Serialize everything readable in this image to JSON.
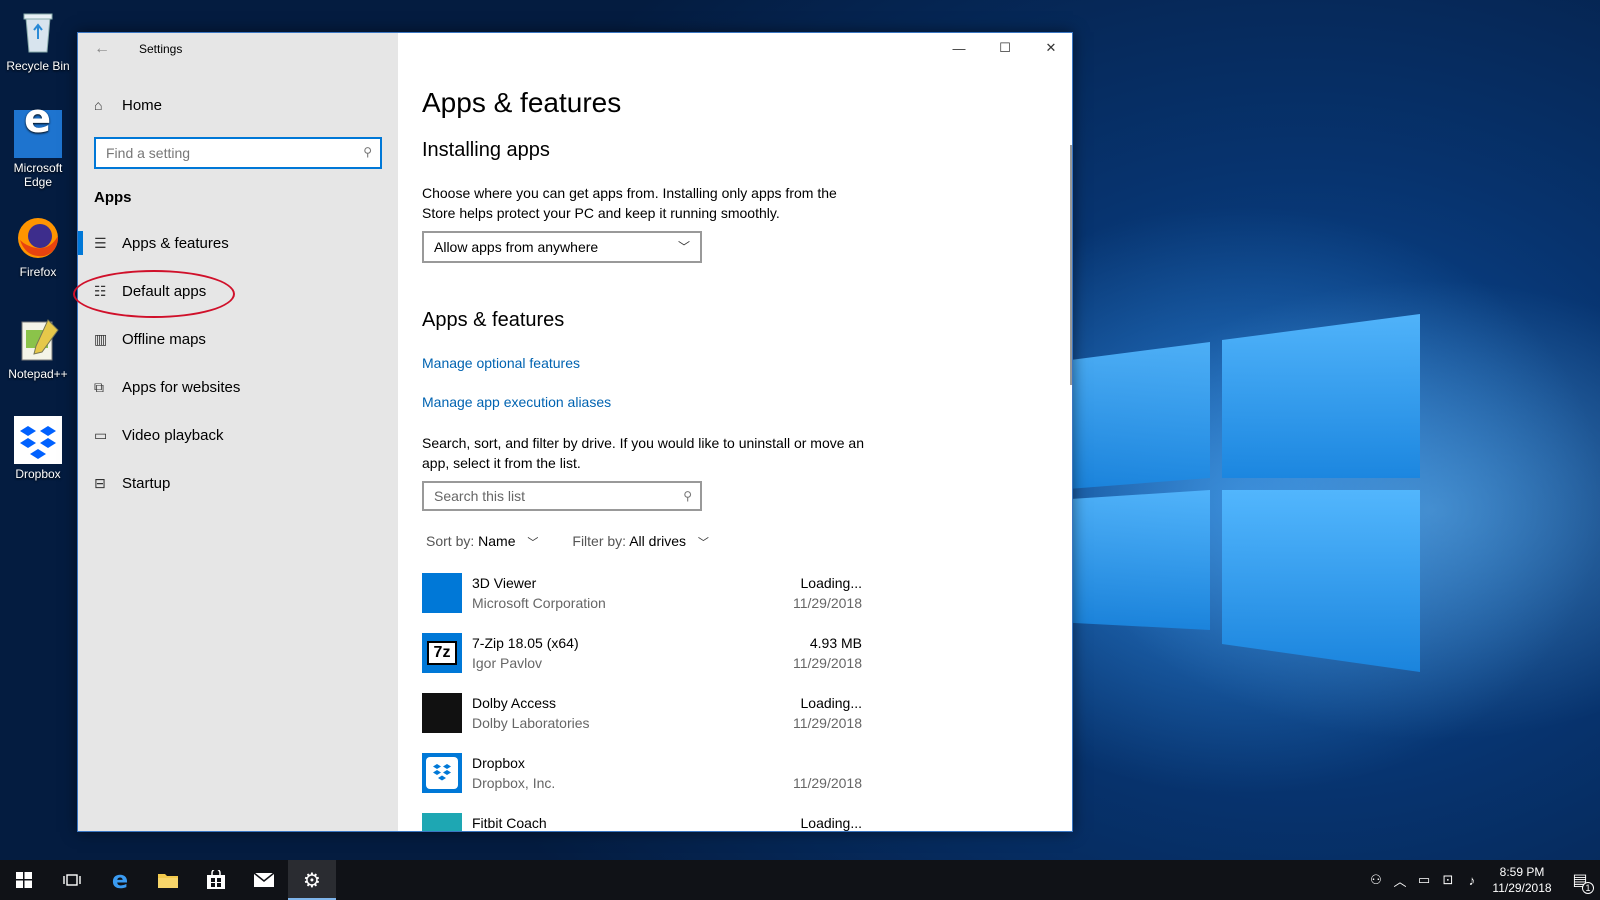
{
  "desktop": {
    "icons": [
      {
        "label_line1": "Recycle Bin",
        "label_line2": "",
        "icon": "recycle-bin-icon"
      },
      {
        "label_line1": "Microsoft",
        "label_line2": "Edge",
        "icon": "edge-icon"
      },
      {
        "label_line1": "Firefox",
        "label_line2": "",
        "icon": "firefox-icon"
      },
      {
        "label_line1": "Notepad++",
        "label_line2": "",
        "icon": "notepadpp-icon"
      },
      {
        "label_line1": "Dropbox",
        "label_line2": "",
        "icon": "dropbox-icon"
      }
    ]
  },
  "window": {
    "title": "Settings",
    "controls": {
      "minimize": "—",
      "maximize": "☐",
      "close": "✕"
    }
  },
  "sidebar": {
    "home_label": "Home",
    "search_placeholder": "Find a setting",
    "section_label": "Apps",
    "items": [
      {
        "label": "Apps & features",
        "icon": "list-icon",
        "active": true
      },
      {
        "label": "Default apps",
        "icon": "default-apps-icon",
        "active": false,
        "highlighted": true
      },
      {
        "label": "Offline maps",
        "icon": "map-icon",
        "active": false
      },
      {
        "label": "Apps for websites",
        "icon": "websites-icon",
        "active": false
      },
      {
        "label": "Video playback",
        "icon": "video-icon",
        "active": false
      },
      {
        "label": "Startup",
        "icon": "startup-icon",
        "active": false
      }
    ]
  },
  "main": {
    "page_title": "Apps & features",
    "installing": {
      "heading": "Installing apps",
      "description": "Choose where you can get apps from. Installing only apps from the Store helps protect your PC and keep it running smoothly.",
      "dropdown_value": "Allow apps from anywhere"
    },
    "features": {
      "heading": "Apps & features",
      "link_optional": "Manage optional features",
      "link_aliases": "Manage app execution aliases",
      "description": "Search, sort, and filter by drive. If you would like to uninstall or move an app, select it from the list.",
      "search_placeholder": "Search this list",
      "sort_label": "Sort by:",
      "sort_value": "Name",
      "filter_label": "Filter by:",
      "filter_value": "All drives"
    },
    "apps": [
      {
        "name": "3D Viewer",
        "publisher": "Microsoft Corporation",
        "size": "Loading...",
        "date": "11/29/2018",
        "color": "#0078d7",
        "icon": "3d-viewer-icon"
      },
      {
        "name": "7-Zip 18.05 (x64)",
        "publisher": "Igor Pavlov",
        "size": "4.93 MB",
        "date": "11/29/2018",
        "color": "#0078d7",
        "icon": "7zip-icon"
      },
      {
        "name": "Dolby Access",
        "publisher": "Dolby Laboratories",
        "size": "Loading...",
        "date": "11/29/2018",
        "color": "#111111",
        "icon": "dolby-icon"
      },
      {
        "name": "Dropbox",
        "publisher": "Dropbox, Inc.",
        "size": "",
        "date": "11/29/2018",
        "color": "#0078d7",
        "icon": "dropbox-icon"
      },
      {
        "name": "Fitbit Coach",
        "publisher": "",
        "size": "Loading...",
        "date": "",
        "color": "#1ea7b3",
        "icon": "fitbit-icon"
      }
    ]
  },
  "taskbar": {
    "time": "8:59 PM",
    "date": "11/29/2018",
    "notification_count": "1"
  }
}
